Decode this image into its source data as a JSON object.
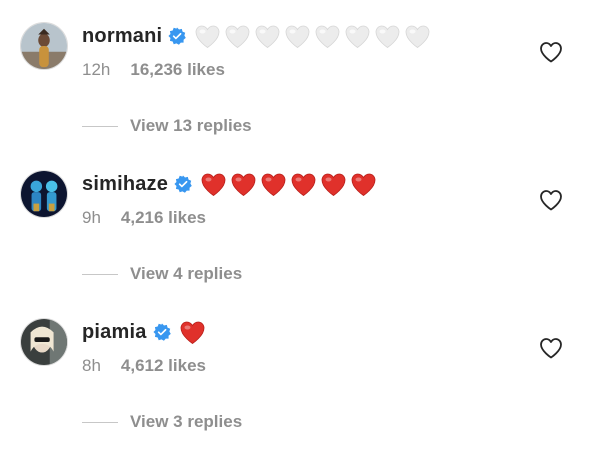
{
  "comments": [
    {
      "username": "normani",
      "verified": true,
      "emoji": "🤍🤍🤍🤍🤍🤍🤍🤍",
      "heart_color": "#ececec",
      "heart_count": 8,
      "time": "12h",
      "likes": "16,236 likes",
      "replies": "View 13 replies"
    },
    {
      "username": "simihaze",
      "verified": true,
      "emoji": "❤️❤️❤️❤️❤️❤️",
      "heart_color": "#e0312b",
      "heart_count": 6,
      "time": "9h",
      "likes": "4,216 likes",
      "replies": "View 4 replies"
    },
    {
      "username": "piamia",
      "verified": true,
      "emoji": "❤️",
      "heart_color": "#e0312b",
      "heart_count": 1,
      "time": "8h",
      "likes": "4,612 likes",
      "replies": "View 3 replies"
    }
  ],
  "colors": {
    "text": "#262626",
    "secondary": "#8e8e8e",
    "verified": "#3897f0",
    "divider": "#c7c7c7"
  }
}
